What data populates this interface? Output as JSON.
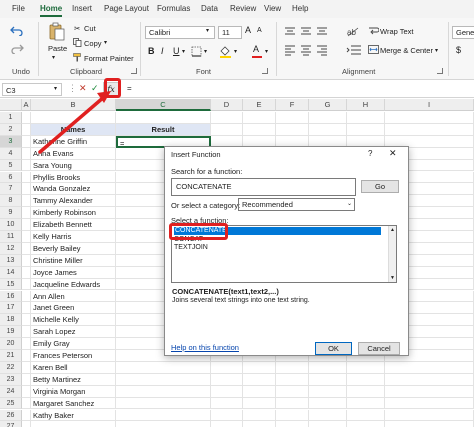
{
  "menu": {
    "tabs": [
      "File",
      "Home",
      "Insert",
      "Page Layout",
      "Formulas",
      "Data",
      "Review",
      "View",
      "Help"
    ],
    "active": "Home"
  },
  "ribbon": {
    "clipboard": {
      "paste": "Paste",
      "cut": "Cut",
      "copy": "Copy",
      "format_painter": "Format Painter",
      "label": "Clipboard"
    },
    "undo_label": "Undo",
    "font": {
      "name": "Calibri",
      "size": "11",
      "bold": "B",
      "italic": "I",
      "underline": "U",
      "grow": "A",
      "shrink": "A",
      "font_color_letter": "A",
      "label": "Font"
    },
    "alignment": {
      "wrap_text": "Wrap Text",
      "merge_center": "Merge & Center",
      "label": "Alignment"
    },
    "number": {
      "format": "Gener"
    },
    "colors": {
      "accent": "#1e6b3c",
      "fill_underline": "#ffd400",
      "font_color_underline": "#e02020"
    }
  },
  "formula_bar": {
    "name_box": "C3",
    "cancel": "✕",
    "enter": "✓",
    "fx": "fx",
    "content": "="
  },
  "sheet": {
    "columns": [
      "A",
      "B",
      "C",
      "D",
      "E",
      "F",
      "G",
      "H",
      "I"
    ],
    "rows": [
      "1",
      "2",
      "3",
      "4",
      "5",
      "6",
      "7",
      "8",
      "9",
      "10",
      "11",
      "12",
      "13",
      "14",
      "15",
      "16",
      "17",
      "18",
      "19",
      "20",
      "21",
      "22",
      "23",
      "24",
      "25",
      "26",
      "27"
    ],
    "header_names": "Names",
    "header_result": "Result",
    "active_cell_value": "=",
    "names": [
      "Katherine Griffin",
      "Anna Evans",
      "Sara Young",
      "Phyllis Brooks",
      "Wanda Gonzalez",
      "Tammy Alexander",
      "Kimberly Robinson",
      "Elizabeth Bennett",
      "Kelly Harris",
      "Beverly Bailey",
      "Christine Miller",
      "Joyce James",
      "Jacqueline Edwards",
      "Ann Allen",
      "Janet Green",
      "Michelle Kelly",
      "Sarah Lopez",
      "Emily Gray",
      "Frances Peterson",
      "Karen Bell",
      "Betty Martinez",
      "Virginia Morgan",
      "Margaret Sanchez",
      "Kathy Baker"
    ]
  },
  "dialog": {
    "title": "Insert Function",
    "help": "?",
    "close": "✕",
    "search_label": "Search for a function:",
    "search_value": "CONCATENATE",
    "go": "Go",
    "category_label": "Or select a category:",
    "category_value": "Recommended",
    "select_label": "Select a function:",
    "functions": [
      "CONCATENATE",
      "CONCAT",
      "TEXTJOIN"
    ],
    "selected": "CONCATENATE",
    "syntax": "CONCATENATE(text1,text2,...)",
    "description": "Joins several text strings into one text string.",
    "help_link": "Help on this function",
    "ok": "OK",
    "cancel": "Cancel"
  }
}
